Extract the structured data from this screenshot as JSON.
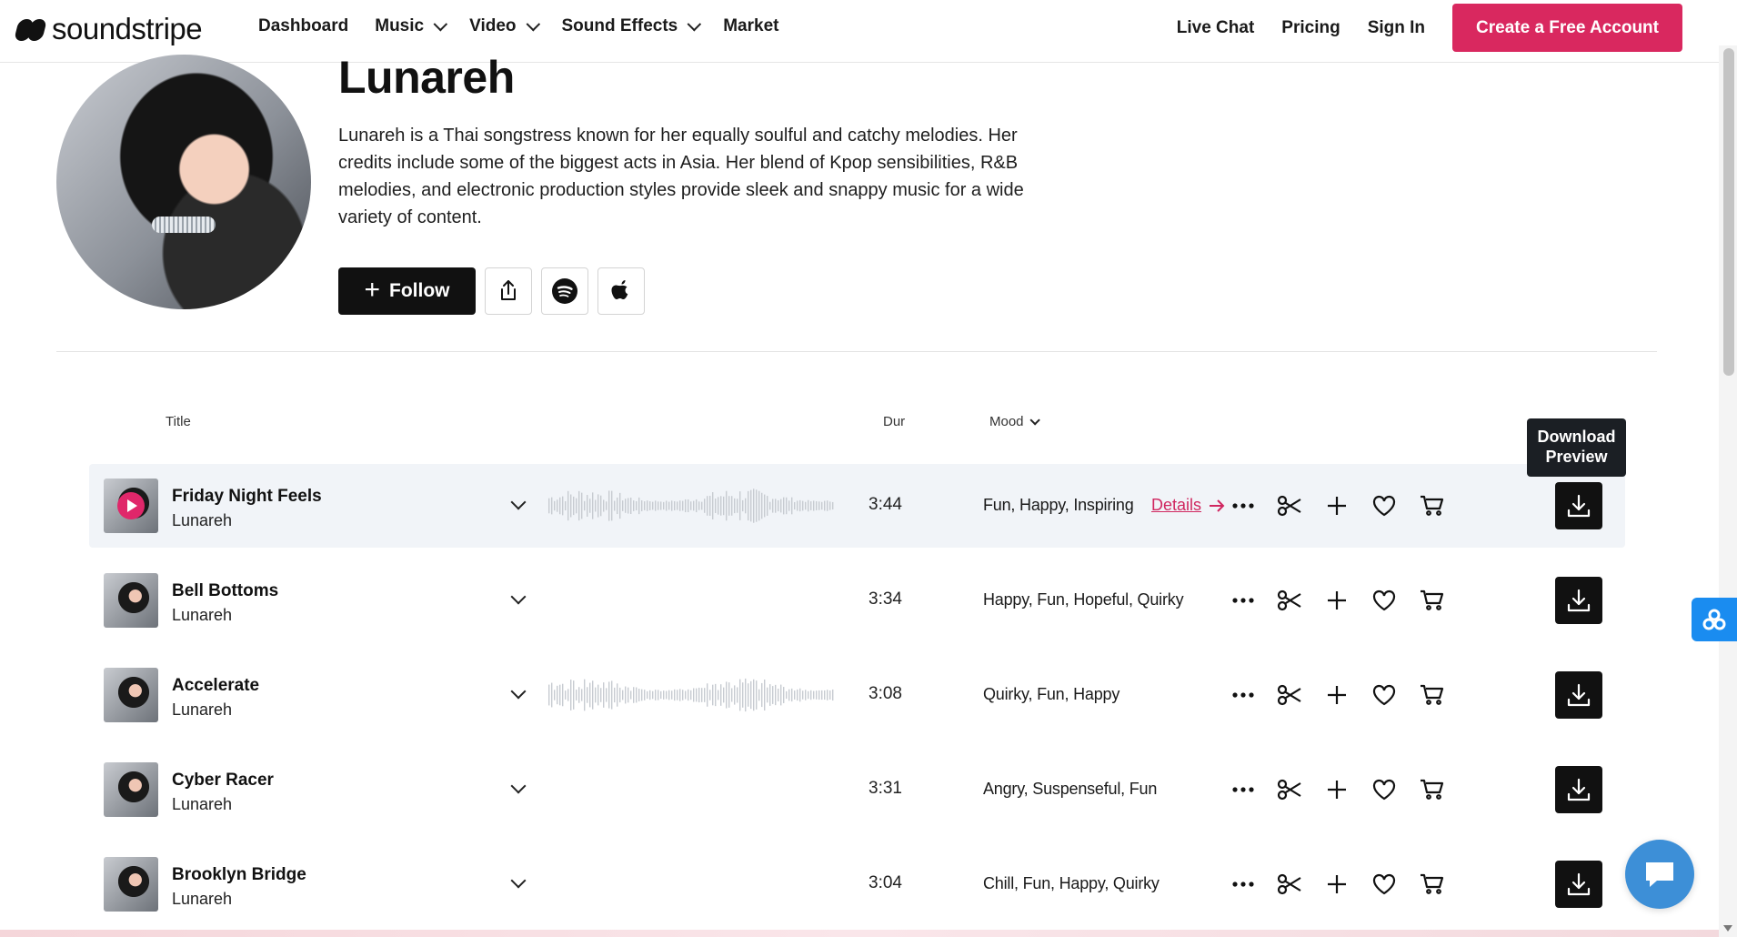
{
  "nav": {
    "logo_text": "soundstripe",
    "links": [
      {
        "label": "Dashboard",
        "has_menu": false
      },
      {
        "label": "Music",
        "has_menu": true
      },
      {
        "label": "Video",
        "has_menu": true
      },
      {
        "label": "Sound Effects",
        "has_menu": true
      },
      {
        "label": "Market",
        "has_menu": false
      }
    ],
    "live_chat": "Live Chat",
    "pricing": "Pricing",
    "sign_in": "Sign In",
    "cta": "Create a Free Account",
    "accent_color": "#d9285f"
  },
  "artist": {
    "name": "Lunareh",
    "bio": "Lunareh is a Thai songstress known for her equally soulful and catchy melodies. Her credits include some of the biggest acts in Asia. Her blend of Kpop sensibilities, R&B melodies, and electronic production styles provide sleek and snappy music for a wide variety of content.",
    "follow_label": "Follow",
    "icons": [
      "share-icon",
      "spotify-icon",
      "apple-icon"
    ]
  },
  "table": {
    "col_title": "Title",
    "col_dur": "Dur",
    "col_mood": "Mood",
    "tooltip": "Download Preview",
    "details_label": "Details",
    "tracks": [
      {
        "title": "Friday Night Feels",
        "artist": "Lunareh",
        "duration": "3:44",
        "mood": "Fun, Happy, Inspiring",
        "playing": true,
        "waveform": true
      },
      {
        "title": "Bell Bottoms",
        "artist": "Lunareh",
        "duration": "3:34",
        "mood": "Happy, Fun, Hopeful, Quirky",
        "playing": false,
        "waveform": false
      },
      {
        "title": "Accelerate",
        "artist": "Lunareh",
        "duration": "3:08",
        "mood": "Quirky, Fun, Happy",
        "playing": false,
        "waveform": true
      },
      {
        "title": "Cyber Racer",
        "artist": "Lunareh",
        "duration": "3:31",
        "mood": "Angry, Suspenseful, Fun",
        "playing": false,
        "waveform": false
      },
      {
        "title": "Brooklyn Bridge",
        "artist": "Lunareh",
        "duration": "3:04",
        "mood": "Chill, Fun, Happy, Quirky",
        "playing": false,
        "waveform": false
      }
    ],
    "row_actions": [
      "more-icon",
      "scissors-icon",
      "plus-icon",
      "heart-icon",
      "cart-icon",
      "download-icon"
    ]
  }
}
